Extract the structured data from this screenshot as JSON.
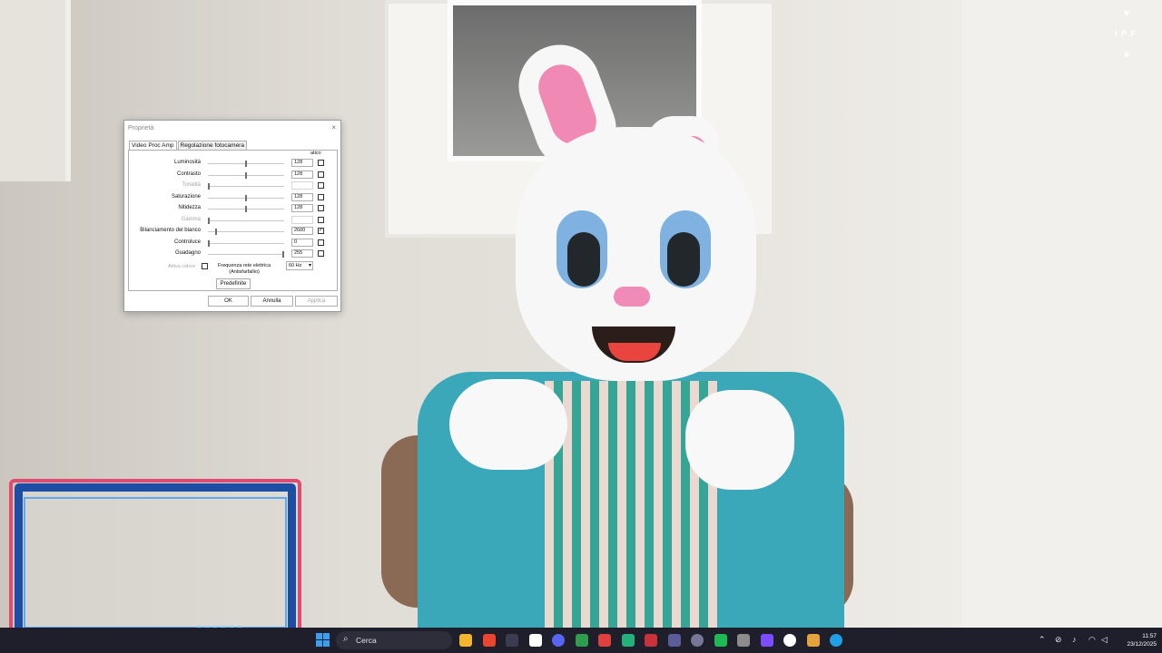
{
  "dialog": {
    "title": "Proprietà",
    "close_label": "×",
    "tabs": [
      "Video Proc Amp",
      "Regolazione fotocamera"
    ],
    "auto_header": "atico",
    "rows": [
      {
        "label": "Luminosità",
        "value": "128",
        "slider": 0.5,
        "enabled": true,
        "auto": false
      },
      {
        "label": "Contrasto",
        "value": "128",
        "slider": 0.5,
        "enabled": true,
        "auto": false
      },
      {
        "label": "Tonalità",
        "value": "",
        "slider": 0.0,
        "enabled": false,
        "auto": false
      },
      {
        "label": "Saturazione",
        "value": "128",
        "slider": 0.5,
        "enabled": true,
        "auto": false
      },
      {
        "label": "Nitidezza",
        "value": "128",
        "slider": 0.5,
        "enabled": true,
        "auto": false
      },
      {
        "label": "Gamma",
        "value": "",
        "slider": 0.0,
        "enabled": false,
        "auto": false
      },
      {
        "label": "Bilanciamento del bianco",
        "value": "2600",
        "slider": 0.1,
        "enabled": true,
        "auto": true
      },
      {
        "label": "Controluce",
        "value": "0",
        "slider": 0.0,
        "enabled": true,
        "auto": false
      },
      {
        "label": "Guadagno",
        "value": "255",
        "slider": 1.0,
        "enabled": true,
        "auto": false
      }
    ],
    "color_enable_label": "Attiva colore",
    "freq_label_line1": "Frequenza rete elettrica",
    "freq_label_line2": "(Antisfarfallio)",
    "freq_value": "60 Hz",
    "defaults_button": "Predefinite",
    "ok_button": "OK",
    "cancel_button": "Annulla",
    "apply_button": "Applica"
  },
  "overlay": {
    "down_arrow": "▼",
    "mid_glyphs": "I P F",
    "up_arrow": "▲"
  },
  "taskbar": {
    "search_placeholder": "Cerca",
    "icons": [
      "file-explorer",
      "browser",
      "app",
      "app",
      "discord",
      "app",
      "app",
      "app",
      "app",
      "app",
      "spotify",
      "app",
      "app",
      "app",
      "chrome",
      "app",
      "edge"
    ],
    "tray_icons": [
      "chevron-up",
      "network-off",
      "microphone",
      "wifi",
      "volume"
    ],
    "time": "11:57",
    "date": "23/12/2025"
  },
  "colors": {
    "frame_blue": "#1d4ea6",
    "frame_pink": "#e24b70",
    "taskbar": "#1f1f2b"
  }
}
